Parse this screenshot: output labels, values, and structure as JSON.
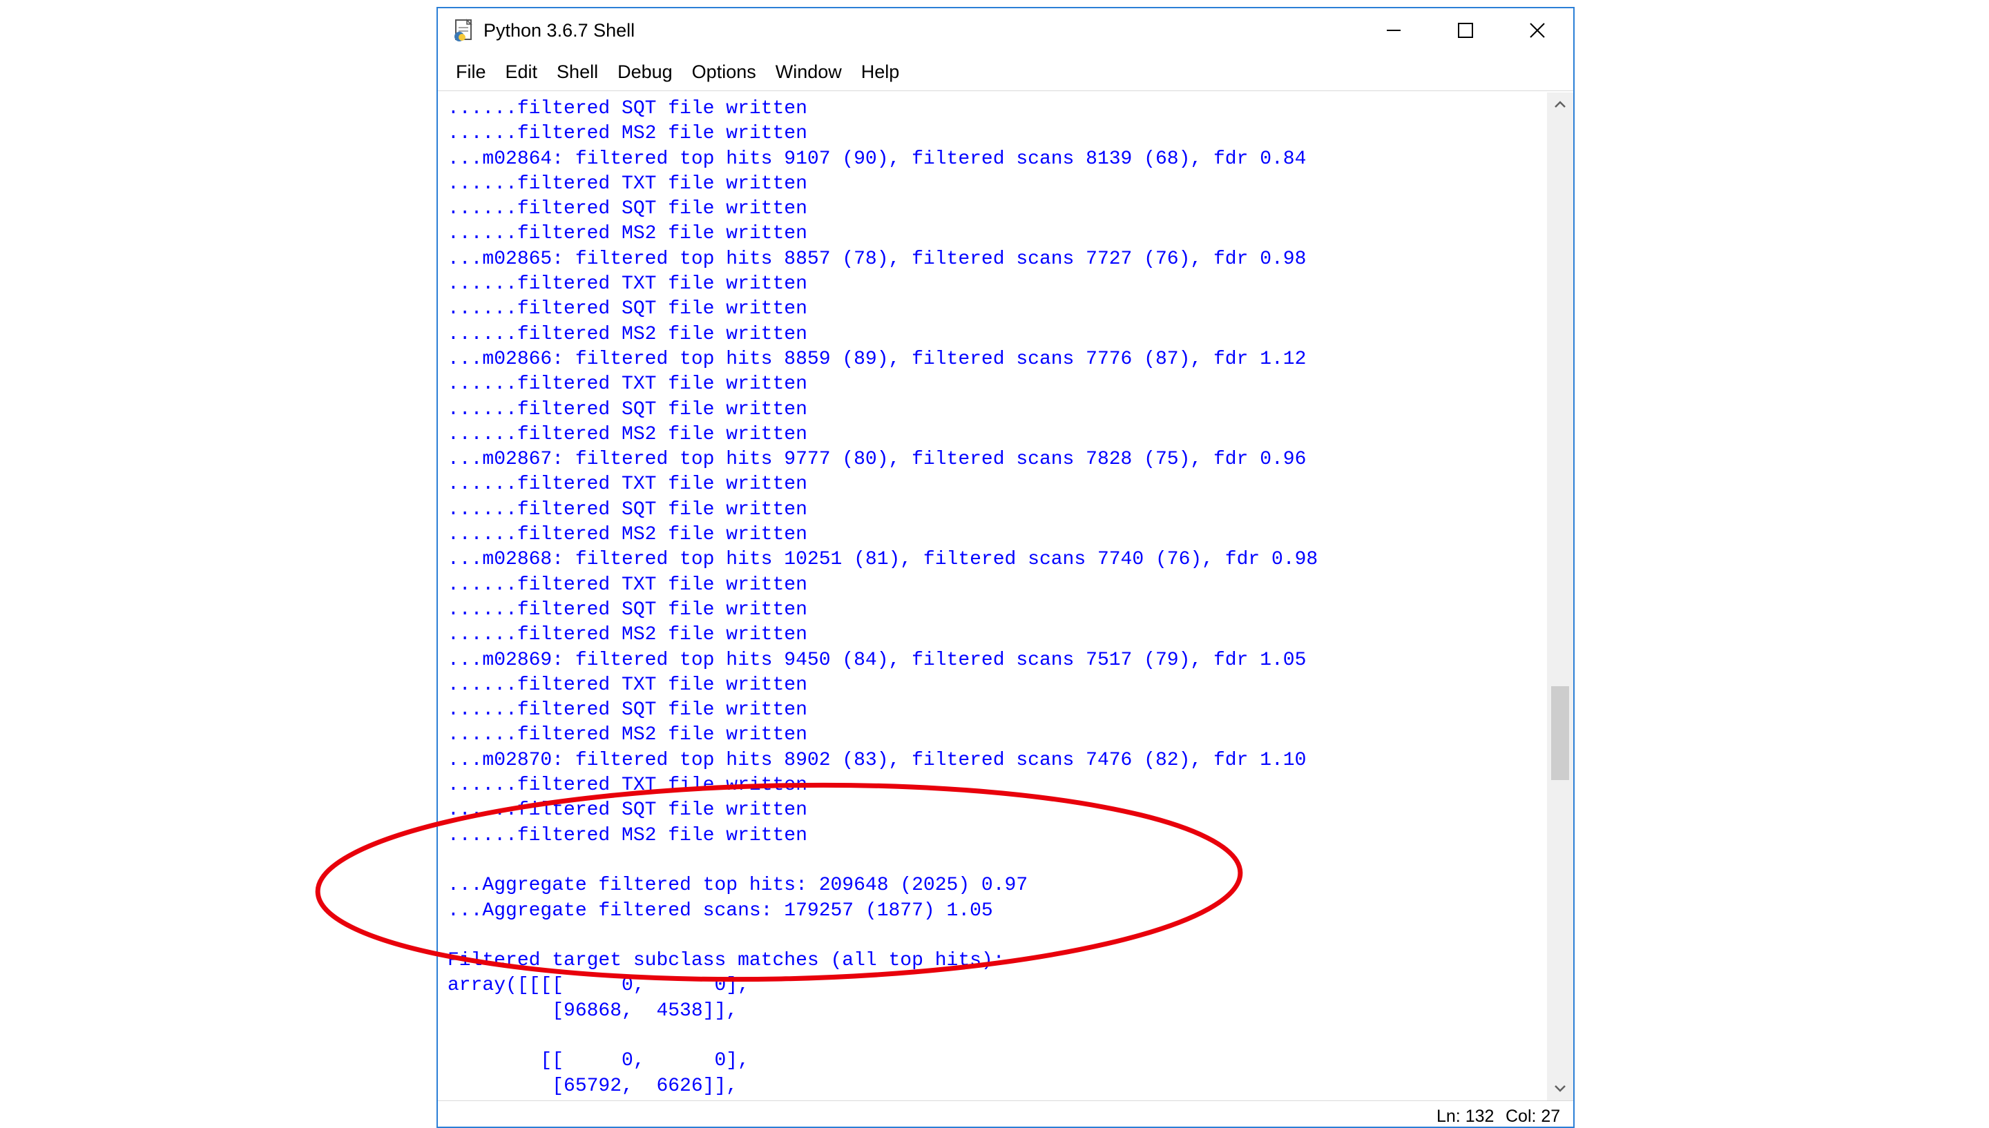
{
  "window": {
    "title": "Python 3.6.7 Shell",
    "accent_color": "#2b7fd6"
  },
  "menu": [
    "File",
    "Edit",
    "Shell",
    "Debug",
    "Options",
    "Window",
    "Help"
  ],
  "editor": {
    "text_color": "#0000ff",
    "lines": [
      "......filtered SQT file written",
      "......filtered MS2 file written",
      "...m02864: filtered top hits 9107 (90), filtered scans 8139 (68), fdr 0.84",
      "......filtered TXT file written",
      "......filtered SQT file written",
      "......filtered MS2 file written",
      "...m02865: filtered top hits 8857 (78), filtered scans 7727 (76), fdr 0.98",
      "......filtered TXT file written",
      "......filtered SQT file written",
      "......filtered MS2 file written",
      "...m02866: filtered top hits 8859 (89), filtered scans 7776 (87), fdr 1.12",
      "......filtered TXT file written",
      "......filtered SQT file written",
      "......filtered MS2 file written",
      "...m02867: filtered top hits 9777 (80), filtered scans 7828 (75), fdr 0.96",
      "......filtered TXT file written",
      "......filtered SQT file written",
      "......filtered MS2 file written",
      "...m02868: filtered top hits 10251 (81), filtered scans 7740 (76), fdr 0.98",
      "......filtered TXT file written",
      "......filtered SQT file written",
      "......filtered MS2 file written",
      "...m02869: filtered top hits 9450 (84), filtered scans 7517 (79), fdr 1.05",
      "......filtered TXT file written",
      "......filtered SQT file written",
      "......filtered MS2 file written",
      "...m02870: filtered top hits 8902 (83), filtered scans 7476 (82), fdr 1.10",
      "......filtered TXT file written",
      "......filtered SQT file written",
      "......filtered MS2 file written",
      "",
      "...Aggregate filtered top hits: 209648 (2025) 0.97",
      "...Aggregate filtered scans: 179257 (1877) 1.05",
      "",
      "Filtered target subclass matches (all top hits):",
      "array([[[[     0,      0],",
      "         [96868,  4538]],",
      "",
      "        [[     0,      0],",
      "         [65792,  6626]],"
    ]
  },
  "status": {
    "line": "Ln: 132",
    "col": "Col: 27"
  },
  "annotation": {
    "color": "#e8000b"
  }
}
